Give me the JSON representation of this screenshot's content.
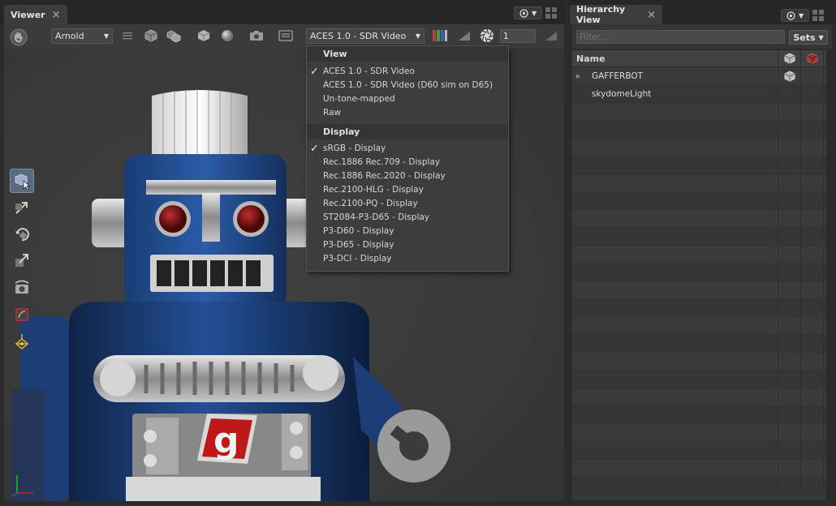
{
  "viewer": {
    "tab_label": "Viewer",
    "renderer": "Arnold",
    "view_transform": "ACES 1.0 - SDR Video",
    "exposure": "1"
  },
  "menu": {
    "view_header": "View",
    "view_items": [
      {
        "label": "ACES 1.0 - SDR Video",
        "checked": true
      },
      {
        "label": "ACES 1.0 - SDR Video (D60 sim on D65)",
        "checked": false
      },
      {
        "label": "Un-tone-mapped",
        "checked": false
      },
      {
        "label": "Raw",
        "checked": false
      }
    ],
    "display_header": "Display",
    "display_items": [
      {
        "label": "sRGB - Display",
        "checked": true
      },
      {
        "label": "Rec.1886 Rec.709 - Display",
        "checked": false
      },
      {
        "label": "Rec.1886 Rec.2020 - Display",
        "checked": false
      },
      {
        "label": "Rec.2100-HLG - Display",
        "checked": false
      },
      {
        "label": "Rec.2100-PQ - Display",
        "checked": false
      },
      {
        "label": "ST2084-P3-D65 - Display",
        "checked": false
      },
      {
        "label": "P3-D60 - Display",
        "checked": false
      },
      {
        "label": "P3-D65 - Display",
        "checked": false
      },
      {
        "label": "P3-DCI - Display",
        "checked": false
      }
    ],
    "check_glyph": "✓"
  },
  "hierarchy": {
    "tab_label": "Hierarchy View",
    "filter_placeholder": "Filter...",
    "sets_label": "Sets",
    "column_name": "Name",
    "rows": [
      {
        "name": "GAFFERBOT",
        "expandable": true,
        "visible_icon": true
      },
      {
        "name": "skydomeLight",
        "expandable": false,
        "visible_icon": false
      }
    ]
  },
  "colors": {
    "panel_bg": "#2b2b2b",
    "toolbar_bg": "#3b3b3b",
    "menu_bg": "#3d3d3d",
    "robot_blue": "#1f4a8c",
    "active_tool": "#5a6b80"
  }
}
